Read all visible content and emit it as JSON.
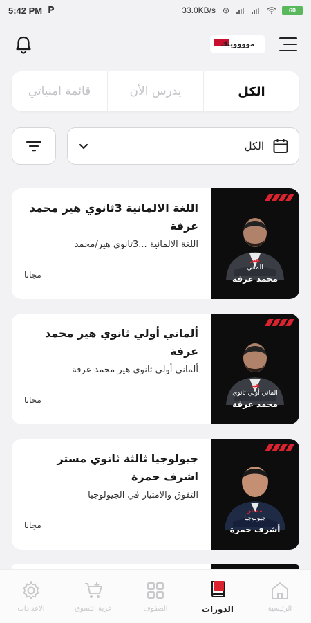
{
  "status_bar": {
    "time": "5:42 PM",
    "app_letter": "P",
    "speed": "33.0KB/s",
    "battery": "60"
  },
  "header": {
    "logo_text": "موووويبك"
  },
  "tabs": [
    {
      "label": "الكل",
      "active": true
    },
    {
      "label": "يدرس الأن",
      "active": false
    },
    {
      "label": "قائمة امنياتي",
      "active": false
    }
  ],
  "filter": {
    "selected": "الكل"
  },
  "courses": [
    {
      "title": "اللغة الالمانية 3ثانوي هير محمد عرفة",
      "description": "اللغة الالمانية ...3ثانوي هير/محمد",
      "price": "مجانا",
      "thumb_subject": "الماني",
      "thumb_tag": "هير",
      "thumb_teacher": "محمد عرفة"
    },
    {
      "title": "ألماني أولي ثانوي هير محمد عرفة",
      "description": "ألماني أولي ثانوي هير محمد عرفة",
      "price": "مجانا",
      "thumb_subject": "الماني أولي ثانوي",
      "thumb_tag": "هير",
      "thumb_teacher": "محمد عرفة"
    },
    {
      "title": "جيولوجيا ثالثة ثانوي مستر اشرف حمزة",
      "description": "التفوق والامتياز في الجيولوجيا",
      "price": "مجانا",
      "thumb_subject": "جيولوجيا",
      "thumb_tag": "مستر",
      "thumb_teacher": "أشرف حمزة"
    }
  ],
  "bottom_nav": [
    {
      "label": "الاعدادات",
      "icon": "gear-icon",
      "active": false
    },
    {
      "label": "عربة التسوق",
      "icon": "cart-icon",
      "active": false
    },
    {
      "label": "الصفوف",
      "icon": "grid-icon",
      "active": false
    },
    {
      "label": "الدورات",
      "icon": "book-icon",
      "active": true
    },
    {
      "label": "الرئيسية",
      "icon": "home-icon",
      "active": false
    }
  ],
  "colors": {
    "accent": "#d9232f",
    "background": "#f2f2f4",
    "battery": "#58b85b"
  }
}
